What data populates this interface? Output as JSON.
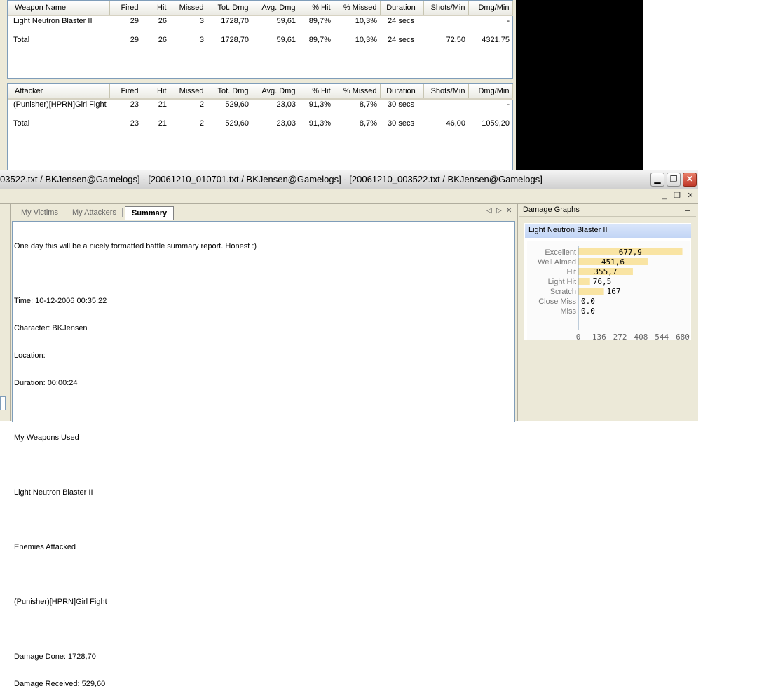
{
  "weapons_table": {
    "headers": [
      "Weapon Name",
      "Fired",
      "Hit",
      "Missed",
      "Tot. Dmg",
      "Avg. Dmg",
      "% Hit",
      "% Missed",
      "Duration",
      "Shots/Min",
      "Dmg/Min"
    ],
    "rows": [
      [
        "Light Neutron Blaster II",
        "29",
        "26",
        "3",
        "1728,70",
        "59,61",
        "89,7%",
        "10,3%",
        "24 secs",
        "",
        "-"
      ],
      [
        "Total",
        "29",
        "26",
        "3",
        "1728,70",
        "59,61",
        "89,7%",
        "10,3%",
        "24 secs",
        "72,50",
        "4321,75"
      ]
    ]
  },
  "attackers_table": {
    "headers": [
      "Attacker",
      "Fired",
      "Hit",
      "Missed",
      "Tot. Dmg",
      "Avg. Dmg",
      "% Hit",
      "% Missed",
      "Duration",
      "Shots/Min",
      "Dmg/Min"
    ],
    "rows": [
      [
        "(Punisher)[HPRN]Girl Fight",
        "23",
        "21",
        "2",
        "529,60",
        "23,03",
        "91,3%",
        "8,7%",
        "30 secs",
        "",
        "-"
      ],
      [
        "Total",
        "23",
        "21",
        "2",
        "529,60",
        "23,03",
        "91,3%",
        "8,7%",
        "30 secs",
        "46,00",
        "1059,20"
      ]
    ]
  },
  "window": {
    "title": "03522.txt / BKJensen@Gamelogs] - [20061210_010701.txt / BKJensen@Gamelogs] - [20061210_003522.txt / BKJensen@Gamelogs]",
    "minimize": "▁",
    "restore": "❐",
    "close": "✕",
    "mdi_minimize": "‗",
    "mdi_restore": "❐",
    "mdi_close": "✕"
  },
  "tabs": {
    "items": [
      "My Victims",
      "My Attackers",
      "Summary"
    ],
    "active": "Summary",
    "prev": "◁",
    "next": "▷",
    "close": "✕"
  },
  "summary": {
    "lines": [
      "One day this will be a nicely formatted battle summary report. Honest :)",
      "",
      "Time: 10-12-2006 00:35:22",
      "Character: BKJensen",
      "Location:",
      "Duration: 00:00:24",
      "",
      "My Weapons Used",
      "",
      "Light Neutron Blaster II",
      "",
      "Enemies Attacked",
      "",
      "(Punisher)[HPRN]Girl Fight",
      "",
      "Damage Done: 1728,70",
      "Damage Received: 529,60"
    ]
  },
  "damage_graphs": {
    "pane_title": "Damage Graphs",
    "pin": "⊥",
    "graph_title": "Light Neutron Blaster II"
  },
  "chart_data": {
    "type": "bar",
    "orientation": "horizontal",
    "title": "Light Neutron Blaster II",
    "categories": [
      "Excellent",
      "Well Aimed",
      "Hit",
      "Light Hit",
      "Scratch",
      "Close Miss",
      "Miss"
    ],
    "values": [
      677.9,
      451.6,
      355.7,
      76.5,
      167,
      0.0,
      0.0
    ],
    "value_labels": [
      "677,9",
      "451,6",
      "355,7",
      "76,5",
      "167",
      "0.0",
      "0.0"
    ],
    "xticks": [
      0,
      136,
      272,
      408,
      544,
      680
    ],
    "xlim": [
      0,
      680
    ],
    "bar_color": "#f9e4a3",
    "grid": false
  },
  "colors": {
    "window_bg": "#ece9d8",
    "graph_header": "#c2d5f5",
    "close_button": "#c0392b"
  }
}
